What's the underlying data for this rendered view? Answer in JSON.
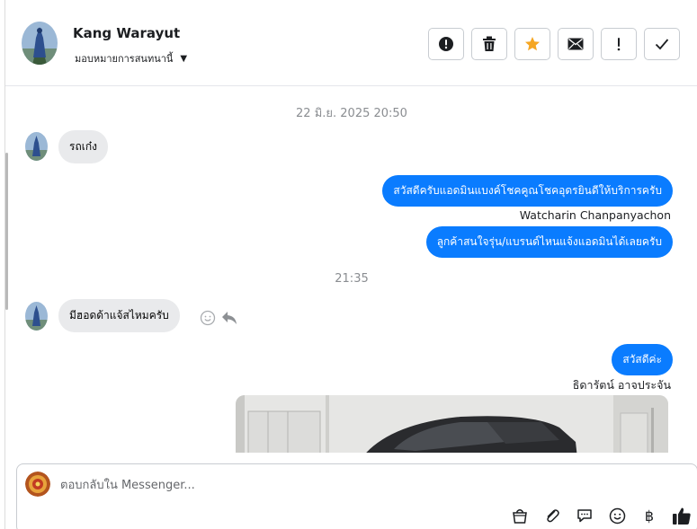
{
  "header": {
    "contact_name": "Kang Warayut",
    "assign_label": "มอบหมายการสนทนานี้",
    "tools": [
      {
        "name": "report-button",
        "icon": "alert-circle-icon"
      },
      {
        "name": "delete-button",
        "icon": "trash-icon"
      },
      {
        "name": "star-button",
        "icon": "star-icon"
      },
      {
        "name": "mark-unread-button",
        "icon": "envelope-icon"
      },
      {
        "name": "follow-up-button",
        "icon": "exclamation-icon"
      },
      {
        "name": "mark-done-button",
        "icon": "check-icon"
      }
    ]
  },
  "chat": {
    "timestamp_1": "22 มิ.ย. 2025 20:50",
    "timestamp_2": "21:35",
    "messages": [
      {
        "direction": "in",
        "text": "รถเก๋ง"
      },
      {
        "direction": "out",
        "text": "สวัสดีครับแอดมินแบงค์โชคคูณโชคอุดรยินดีให้บริการครับ",
        "sender": "Watcharin Chanpanyachon"
      },
      {
        "direction": "out",
        "text": "ลูกค้าสนใจรุ่น/แบรนด์ไหนแจ้งแอดมินได้เลยครับ"
      },
      {
        "direction": "in",
        "text": "มีฮอดด้าแจ้สไหมครับ"
      },
      {
        "direction": "out",
        "text": "สวัสดีค่ะ",
        "sender": "ธิดารัตน์ อาจประจัน"
      }
    ]
  },
  "composer": {
    "placeholder": "ตอบกลับใน Messenger..."
  },
  "colors": {
    "outgoing_bubble": "#0a7cff",
    "incoming_bubble": "#e9eaec",
    "star": "#f5a623"
  }
}
